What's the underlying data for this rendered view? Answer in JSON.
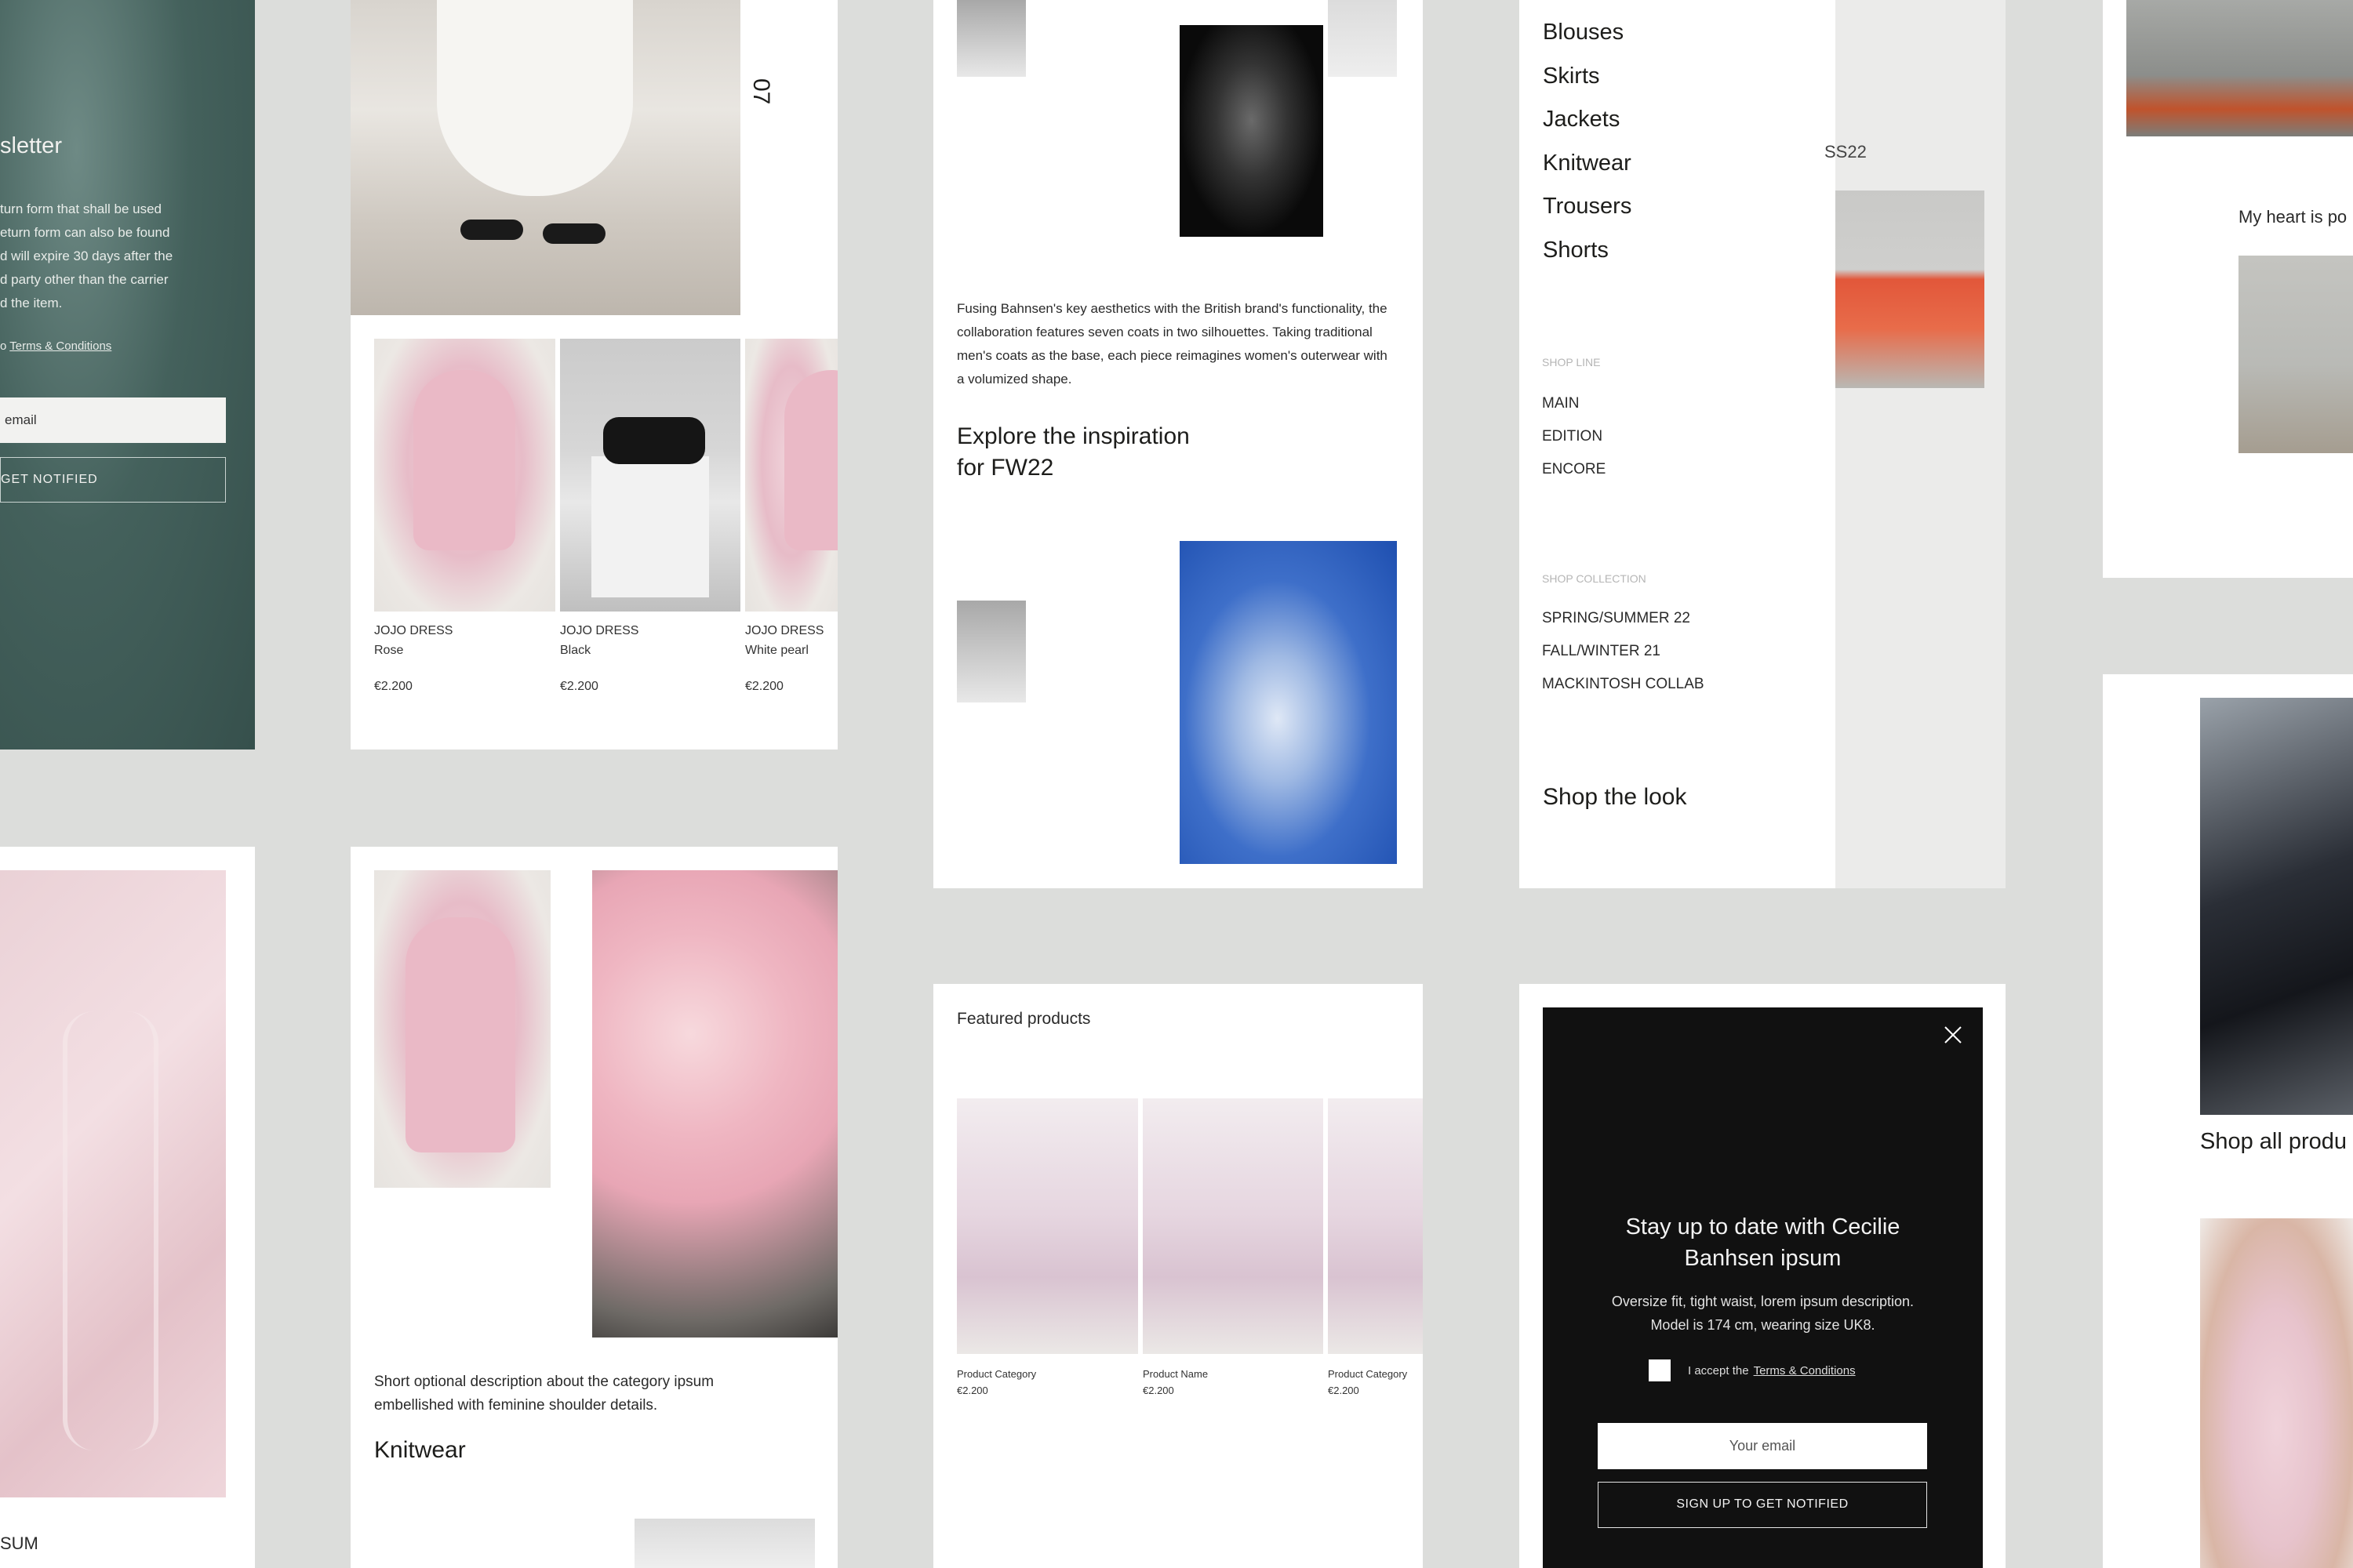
{
  "newsletter_card": {
    "heading": "sletter",
    "body_lines": [
      "turn form that shall be used",
      "eturn form can also be found",
      "d will expire 30 days after the",
      "d party other than the carrier",
      "d the item."
    ],
    "terms_prefix": "o",
    "terms_link": "Terms & Conditions",
    "email_placeholder": "email",
    "cta": "GET NOTIFIED"
  },
  "product_row_card": {
    "page_number": "07",
    "products": [
      {
        "name": "JOJO DRESS",
        "variant": "Rose",
        "price": "€2.200"
      },
      {
        "name": "JOJO DRESS",
        "variant": "Black",
        "price": "€2.200"
      },
      {
        "name": "JOJO DRESS",
        "variant": "White pearl",
        "price": "€2.200"
      }
    ]
  },
  "inspiration_card": {
    "body": "Fusing Bahnsen's key aesthetics with the British brand's functionality, the collaboration features seven coats in two silhouettes. Taking traditional men's coats as the base, each piece reimagines women's outerwear with a volumized shape.",
    "heading_line1": "Explore the inspiration",
    "heading_line2": "for FW22"
  },
  "menu_card": {
    "categories": [
      "Blouses",
      "Skirts",
      "Jackets",
      "Knitwear",
      "Trousers",
      "Shorts"
    ],
    "shop_line_label": "SHOP LINE",
    "shop_line_items": [
      "MAIN",
      "EDITION",
      "ENCORE"
    ],
    "shop_collection_label": "SHOP COLLECTION",
    "shop_collection_items": [
      "SPRING/SUMMER 22",
      "FALL/WINTER 21",
      "MACKINTOSH COLLAB"
    ],
    "shop_the_look": "Shop the look",
    "season_tag": "SS22"
  },
  "heart_card": {
    "caption": "My heart is po"
  },
  "bottom_left_card": {
    "caption": "SUM"
  },
  "knitwear_card": {
    "description": "Short optional description about the category ipsum embellished with feminine shoulder details.",
    "title": "Knitwear"
  },
  "featured_card": {
    "heading": "Featured products",
    "products": [
      {
        "label": "Product Category",
        "price": "€2.200"
      },
      {
        "label": "Product Name",
        "price": "€2.200"
      },
      {
        "label": "Product Category",
        "price": "€2.200"
      }
    ]
  },
  "signup_modal": {
    "title_line1": "Stay up to date with Cecilie",
    "title_line2": "Banhsen ipsum",
    "desc_line1": "Oversize fit, tight waist, lorem ipsum description.",
    "desc_line2": "Model is 174 cm, wearing size UK8.",
    "accept_prefix": "I accept the",
    "accept_link": "Terms & Conditions",
    "email_placeholder": "Your email",
    "cta": "SIGN UP TO GET NOTIFIED",
    "close_icon": "close-icon"
  },
  "shop_all_card": {
    "caption": "Shop all produ"
  },
  "colors": {
    "background": "#dcdddb",
    "card": "#ffffff",
    "modal": "#111111",
    "text": "#1d1d1b",
    "muted": "#b5b5b5"
  }
}
